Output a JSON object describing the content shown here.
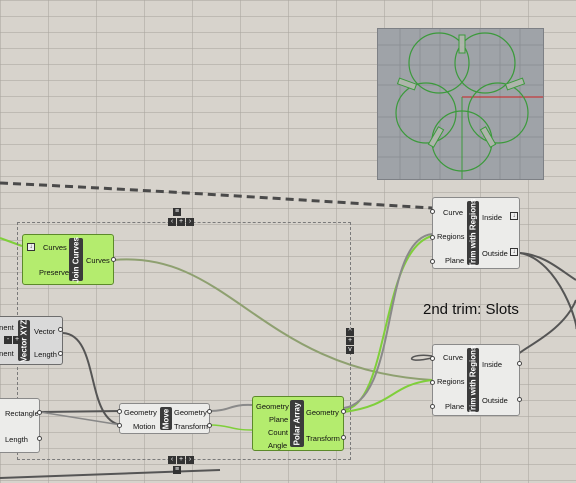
{
  "note": "2nd trim: Slots",
  "components": {
    "join_curves": {
      "title": "Join Curves",
      "inputs": [
        "Curves",
        "Preserve"
      ],
      "outputs": [
        "Curves"
      ]
    },
    "vector_xyz": {
      "title": "Vector XYZ",
      "inputs": [
        "onent",
        "onent"
      ],
      "outputs": [
        "Vector",
        "Length"
      ]
    },
    "rectangle": {
      "outputs": [
        "Rectangle",
        "Length"
      ]
    },
    "move": {
      "title": "Move",
      "inputs": [
        "Geometry",
        "Motion"
      ],
      "outputs": [
        "Geometry",
        "Transform"
      ]
    },
    "polar_array": {
      "title": "Polar Array",
      "inputs": [
        "Geometry",
        "Plane",
        "Count",
        "Angle"
      ],
      "outputs": [
        "Geometry",
        "Transform"
      ]
    },
    "trim_1": {
      "title": "Trim with Regions",
      "inputs": [
        "Curve",
        "Regions",
        "Plane"
      ],
      "outputs": [
        "Inside",
        "Outside"
      ]
    },
    "trim_2": {
      "title": "Trim with Regions",
      "inputs": [
        "Curve",
        "Regions",
        "Plane"
      ],
      "outputs": [
        "Inside",
        "Outside"
      ]
    }
  },
  "icons": [
    "cluster-control-icon",
    "download-arrow-icon"
  ],
  "colors": {
    "canvas": "#d7d3cc",
    "component_green": "#b4ec6e",
    "wire_selected": "#7fcf3a",
    "preview_green": "#3b9a3b",
    "axis_red": "#cc2222"
  }
}
